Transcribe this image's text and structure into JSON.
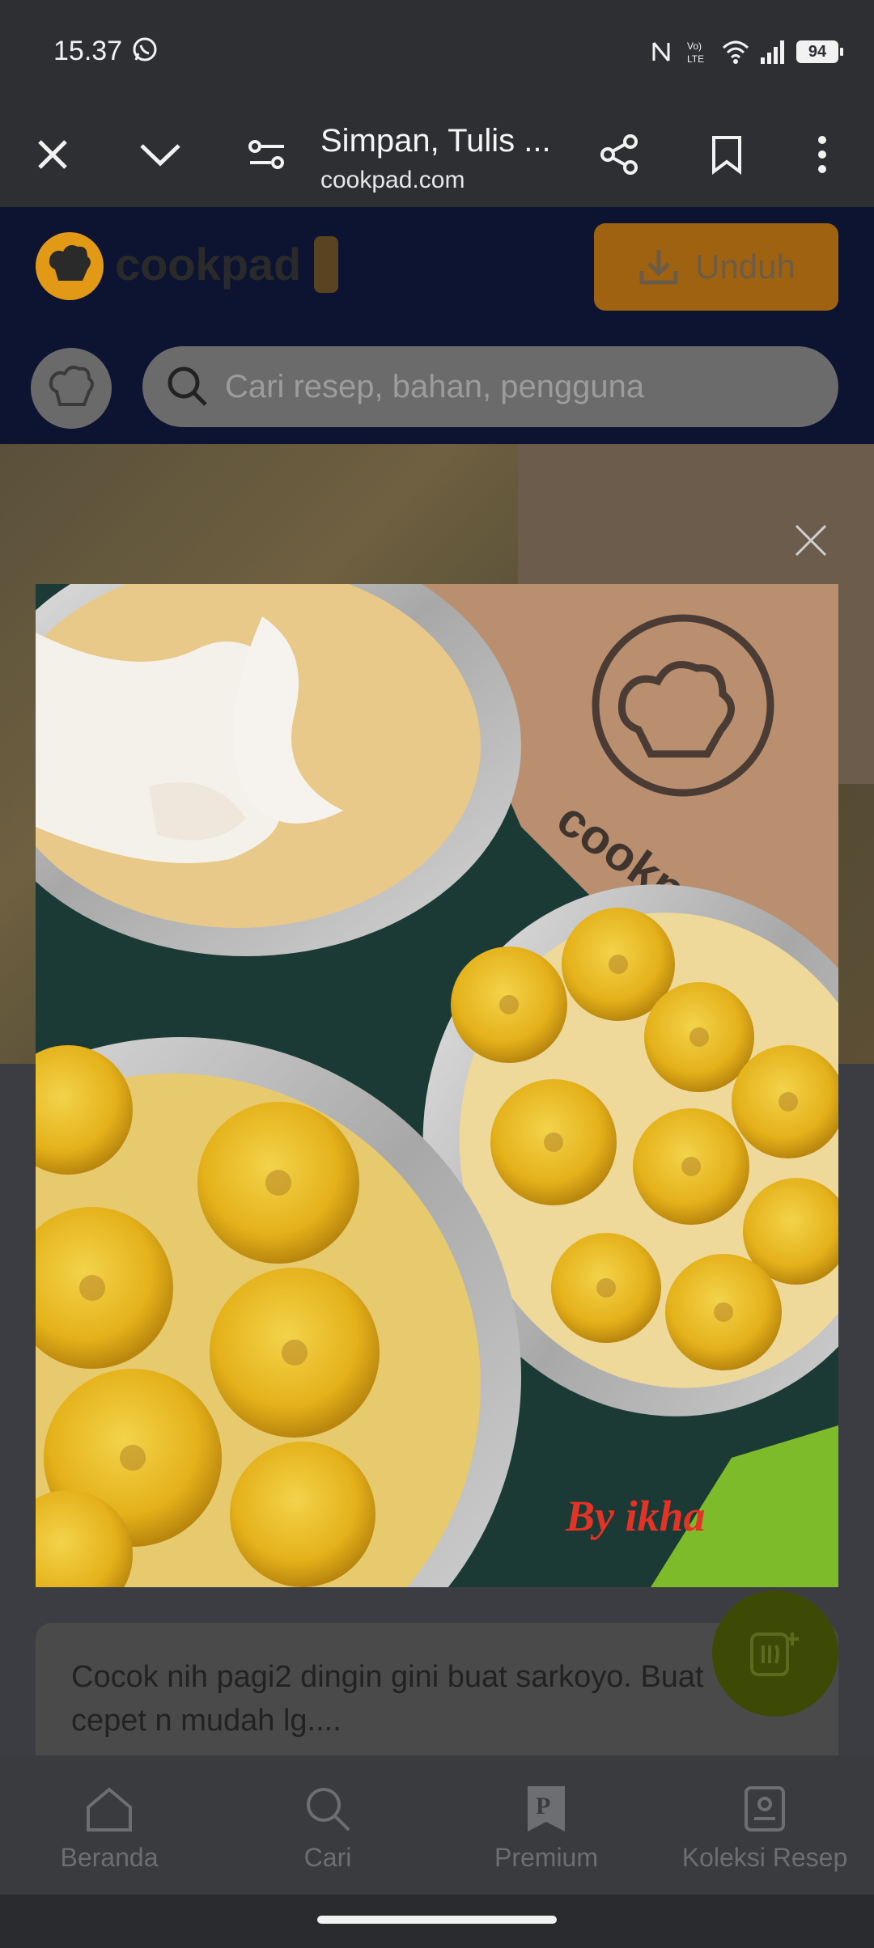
{
  "status_bar": {
    "time": "15.37",
    "battery": "94",
    "icons": [
      "whatsapp-icon",
      "nfc-icon",
      "volte-icon",
      "wifi-icon",
      "signal-icon",
      "battery-icon"
    ]
  },
  "toolbar": {
    "title": "Simpan, Tulis ...",
    "url": "cookpad.com",
    "icons": [
      "close-icon",
      "chevron-down-icon",
      "site-settings-icon",
      "share-icon",
      "bookmark-icon",
      "more-vert-icon"
    ]
  },
  "header": {
    "logo_text": "cookpad",
    "download_label": "Unduh",
    "search_placeholder": "Cari resep, bahan, pengguna"
  },
  "recipe": {
    "description": "Cocok nih pagi2 dingin gini buat sarkoyo. Buat cepet n mudah lg....",
    "photo_watermark_brand": "cookpad",
    "photo_caption": "By ikha"
  },
  "bottom_nav": {
    "items": [
      {
        "label": "Beranda",
        "icon": "home-icon"
      },
      {
        "label": "Cari",
        "icon": "search-icon"
      },
      {
        "label": "Premium",
        "icon": "premium-icon"
      },
      {
        "label": "Koleksi Resep",
        "icon": "recipe-collection-icon"
      }
    ]
  },
  "colors": {
    "brand_orange": "#e29a16",
    "accent_green": "#3c4a06",
    "header_navy": "#0d1431"
  }
}
